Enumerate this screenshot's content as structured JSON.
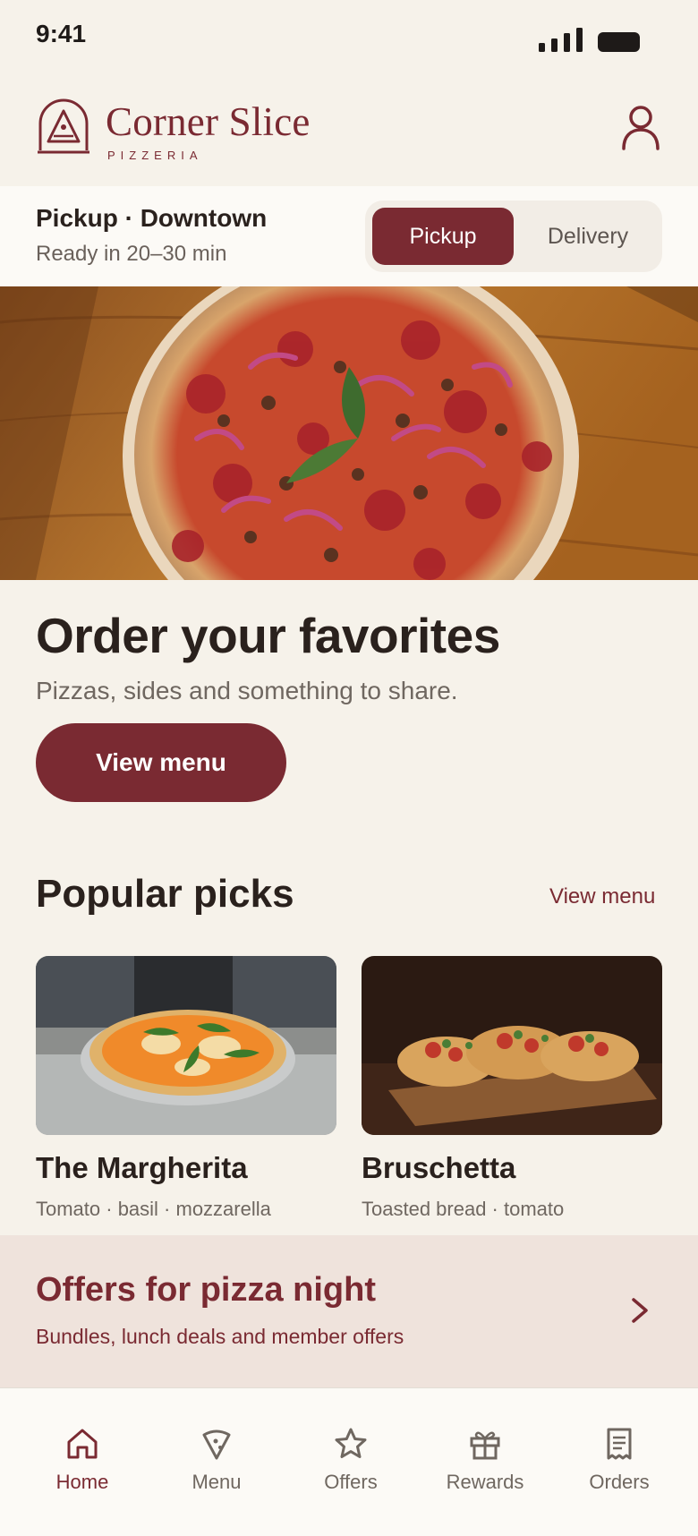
{
  "status": {
    "time": "9:41"
  },
  "brand": {
    "name": "Corner Slice",
    "sub": "PIZZERIA"
  },
  "mode": {
    "title": "Pickup · Downtown",
    "subtitle": "Ready in 20–30 min",
    "options": [
      "Pickup",
      "Delivery"
    ],
    "selected": "Pickup"
  },
  "hero": {
    "headline": "Order your favorites",
    "subhead": "Pizzas, sides and something to share.",
    "cta": "View menu"
  },
  "popular": {
    "title": "Popular picks",
    "link": "View menu",
    "items": [
      {
        "name": "The Margherita",
        "desc": "Tomato · basil · mozzarella"
      },
      {
        "name": "Bruschetta",
        "desc": "Toasted bread · tomato"
      }
    ]
  },
  "offers": {
    "title": "Offers for pizza night",
    "subtitle": "Bundles, lunch deals and member offers"
  },
  "tabs": [
    {
      "label": "Home",
      "icon": "home-icon",
      "active": true
    },
    {
      "label": "Menu",
      "icon": "pizza-slice-icon",
      "active": false
    },
    {
      "label": "Offers",
      "icon": "star-icon",
      "active": false
    },
    {
      "label": "Rewards",
      "icon": "gift-icon",
      "active": false
    },
    {
      "label": "Orders",
      "icon": "receipt-icon",
      "active": false
    }
  ],
  "colors": {
    "accent": "#7a2a32",
    "background": "#f6f2ea",
    "offers_bg": "#efe3dc"
  }
}
